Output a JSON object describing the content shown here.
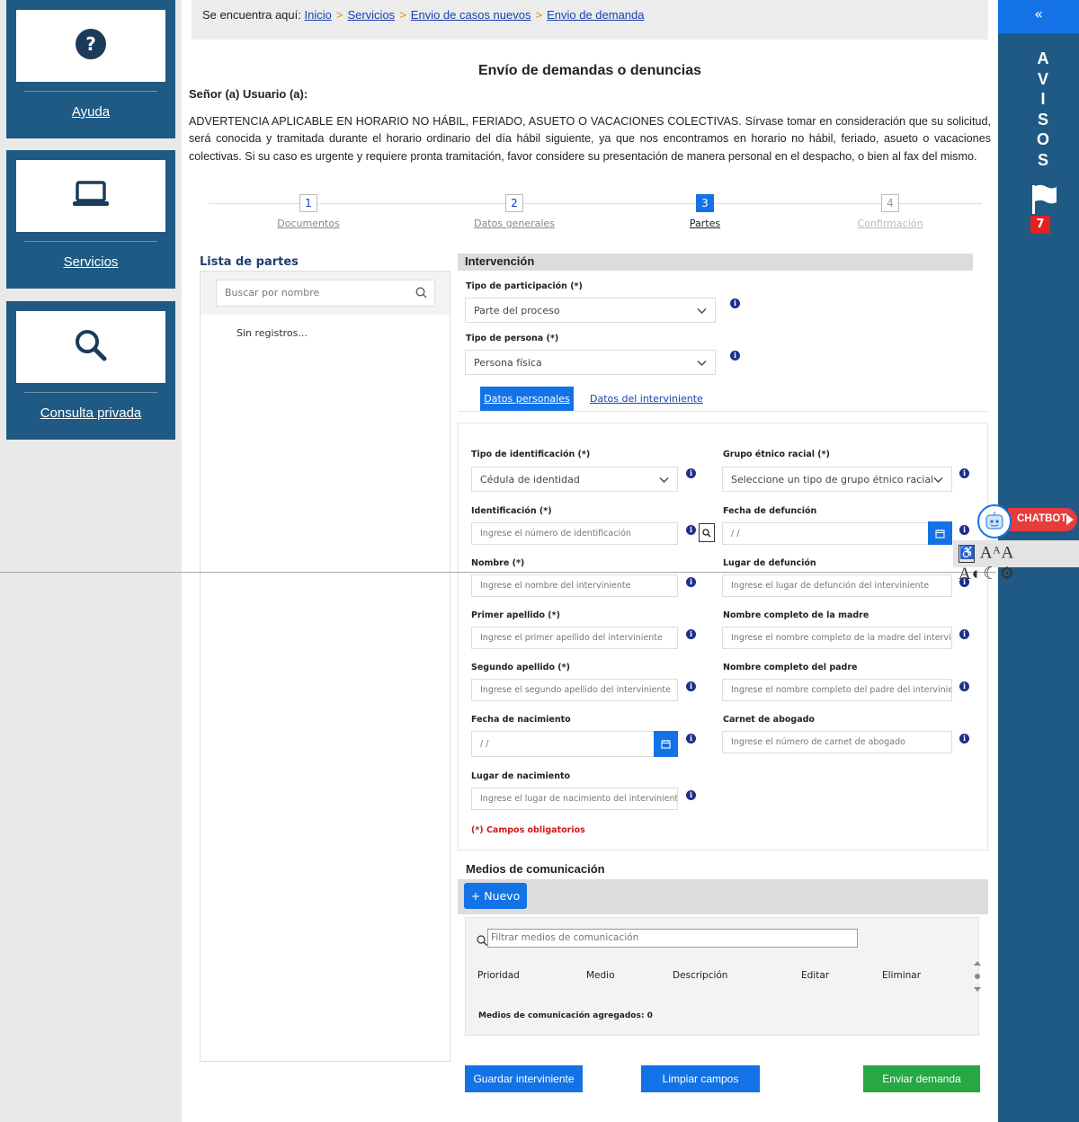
{
  "sidebar": {
    "items": [
      {
        "label": "Ayuda",
        "icon": "help-icon"
      },
      {
        "label": "Servicios",
        "icon": "laptop-icon"
      },
      {
        "label": "Consulta privada",
        "icon": "search-icon"
      }
    ]
  },
  "breadcrumb": {
    "prefix": "Se encuentra aquí:",
    "items": [
      "Inicio",
      "Servicios",
      "Envio de casos nuevos",
      "Envio de demanda"
    ],
    "separator": ">"
  },
  "page": {
    "title": "Envío de demandas o denuncias",
    "greeting": "Señor (a) Usuario (a):",
    "warning": "ADVERTENCIA APLICABLE EN HORARIO NO HÁBIL, FERIADO, ASUETO O VACACIONES COLECTIVAS. Sírvase tomar en consideración que su solicitud, será conocida y tramitada durante el horario ordinario del día hábil siguiente, ya que nos encontramos en horario no hábil, feriado, asueto o vacaciones colectivas. Si su caso es urgente y requiere pronta tramitación, favor considere su presentación de manera personal en el despacho, o bien al fax del mismo."
  },
  "steps": [
    {
      "num": "1",
      "name": "Documentos"
    },
    {
      "num": "2",
      "name": "Datos generales"
    },
    {
      "num": "3",
      "name": "Partes"
    },
    {
      "num": "4",
      "name": "Confirmación"
    }
  ],
  "partes": {
    "title": "Lista de partes",
    "search_placeholder": "Buscar por nombre",
    "empty": "Sin registros..."
  },
  "intervencion": {
    "title": "Intervención",
    "participacion_label": "Tipo de participación (*)",
    "participacion_value": "Parte del proceso",
    "persona_label": "Tipo de persona (*)",
    "persona_value": "Persona física",
    "tab_personales": "Datos personales",
    "tab_interviniente": "Datos del interviniente"
  },
  "form": {
    "tipo_id_label": "Tipo de identificación (*)",
    "tipo_id_value": "Cédula de identidad",
    "grupo_label": "Grupo étnico racial (*)",
    "grupo_value": "Seleccione un tipo de grupo étnico racial",
    "identificacion_label": "Identificación (*)",
    "identificacion_ph": "Ingrese el número de identificación",
    "fecha_def_label": "Fecha de defunción",
    "fecha_def_ph": "/ /",
    "nombre_label": "Nombre (*)",
    "nombre_ph": "Ingrese el nombre del interviniente",
    "lugar_def_label": "Lugar de defunción",
    "lugar_def_ph": "Ingrese el lugar de defunción del interviniente",
    "apellido1_label": "Primer apellido (*)",
    "apellido1_ph": "Ingrese el primer apellido del interviniente",
    "madre_label": "Nombre completo de la madre",
    "madre_ph": "Ingrese el nombre completo de la madre del intervinie",
    "apellido2_label": "Segundo apellido (*)",
    "apellido2_ph": "Ingrese el segundo apellido del interviniente",
    "padre_label": "Nombre completo del padre",
    "padre_ph": "Ingrese el nombre completo del padre del intervinient",
    "fecha_nac_label": "Fecha de nacimiento",
    "fecha_nac_ph": "/ /",
    "carnet_label": "Carnet de abogado",
    "carnet_ph": "Ingrese el número de carnet de abogado",
    "lugar_nac_label": "Lugar de nacimiento",
    "lugar_nac_ph": "Ingrese el lugar de nacimiento del interviniente",
    "required_note": "(*) Campos obligatorios"
  },
  "medios": {
    "title": "Medios de comunicación",
    "nuevo": "+ Nuevo",
    "filter_ph": "Filtrar medios de comunicación",
    "columns": [
      "Prioridad",
      "Medio",
      "Descripción",
      "Editar",
      "Eliminar"
    ],
    "count": "Medios de comunicación agregados: 0"
  },
  "buttons": {
    "guardar": "Guardar interviniente",
    "limpiar": "Limpiar campos",
    "enviar": "Enviar demanda"
  },
  "avisos": {
    "collapse": "«",
    "letters": [
      "A",
      "V",
      "I",
      "S",
      "O",
      "S"
    ],
    "count": "7"
  },
  "chatbot": {
    "label": "CHATBOT"
  },
  "accessibility": {
    "text": "AᴬA A◐☾⚙"
  },
  "colors": {
    "primary": "#1373e6",
    "sidebar": "#1e5a84",
    "success": "#28a745",
    "danger": "#d01818"
  }
}
